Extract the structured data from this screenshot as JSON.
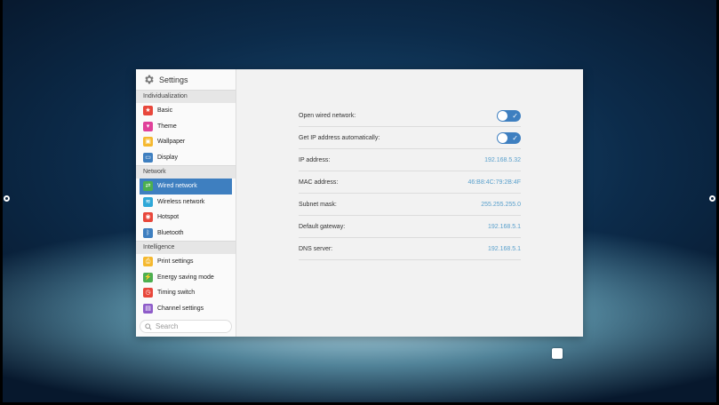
{
  "app": {
    "title": "Settings"
  },
  "sidebar": {
    "sections": [
      {
        "label": "Individualization",
        "items": [
          {
            "label": "Basic",
            "icon": "basic-icon",
            "color": "#e8473b"
          },
          {
            "label": "Theme",
            "icon": "theme-icon",
            "color": "#e0419a"
          },
          {
            "label": "Wallpaper",
            "icon": "wallpaper-icon",
            "color": "#f5b82e"
          },
          {
            "label": "Display",
            "icon": "display-icon",
            "color": "#3e7fc0"
          }
        ]
      },
      {
        "label": "Network",
        "items": [
          {
            "label": "Wired network",
            "icon": "wired-network-icon",
            "color": "#4caf50",
            "active": true
          },
          {
            "label": "Wireless network",
            "icon": "wifi-icon",
            "color": "#2fa8d8"
          },
          {
            "label": "Hotspot",
            "icon": "hotspot-icon",
            "color": "#e8473b"
          },
          {
            "label": "Bluetooth",
            "icon": "bluetooth-icon",
            "color": "#3e7fc0"
          }
        ]
      },
      {
        "label": "Intelligence",
        "items": [
          {
            "label": "Print settings",
            "icon": "print-icon",
            "color": "#f5b82e"
          },
          {
            "label": "Energy saving mode",
            "icon": "energy-icon",
            "color": "#4caf50"
          },
          {
            "label": "Timing switch",
            "icon": "timer-icon",
            "color": "#e8473b"
          },
          {
            "label": "Channel settings",
            "icon": "channel-icon",
            "color": "#8e5cc9"
          }
        ]
      }
    ],
    "search_placeholder": "Search"
  },
  "wired": {
    "open_wired_network": {
      "label": "Open wired network:",
      "on": true
    },
    "auto_ip": {
      "label": "Get IP address automatically:",
      "on": true
    },
    "ip_address": {
      "label": "IP address:",
      "value": "192.168.5.32"
    },
    "mac_address": {
      "label": "MAC address:",
      "value": "46:B8:4C:79:2B:4F"
    },
    "subnet_mask": {
      "label": "Subnet mask:",
      "value": "255.255.255.0"
    },
    "default_gateway": {
      "label": "Default gateway:",
      "value": "192.168.5.1"
    },
    "dns_server": {
      "label": "DNS server:",
      "value": "192.168.5.1"
    }
  },
  "colors": {
    "accent": "#3e7fc0",
    "value_text": "#5aa0cc"
  }
}
